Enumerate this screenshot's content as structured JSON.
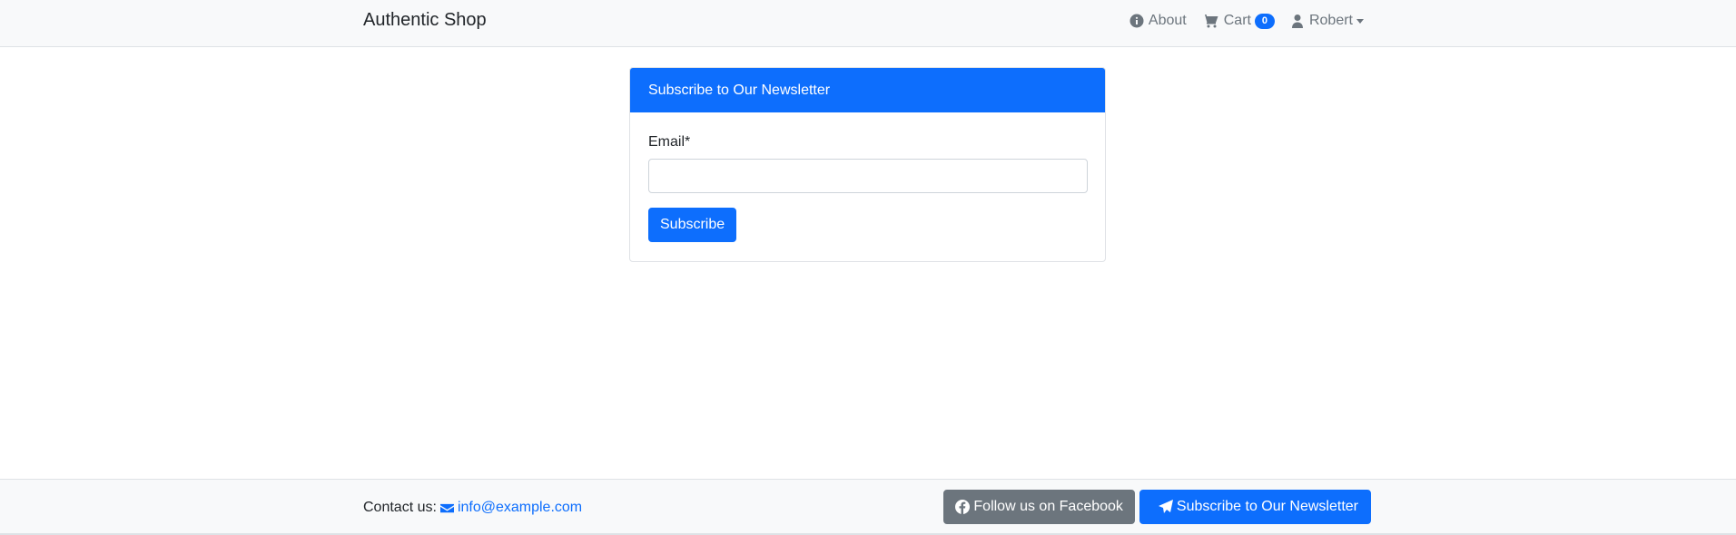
{
  "navbar": {
    "brand": "Authentic Shop",
    "about_label": "About",
    "about_icon": "info-circle-icon",
    "cart_label": "Cart",
    "cart_icon": "shopping-cart-icon",
    "cart_count": "0",
    "user_label": "Robert",
    "user_icon": "user-icon"
  },
  "card": {
    "header": "Subscribe to Our Newsletter",
    "email_label": "Email*",
    "email_value": "",
    "email_placeholder": "",
    "submit_label": "Subscribe"
  },
  "footer": {
    "contact_label": "Contact us:",
    "contact_email": "info@example.com",
    "contact_icon": "envelope-icon",
    "facebook_label": "Follow us on Facebook",
    "facebook_icon": "facebook-icon",
    "newsletter_label": "Subscribe to Our Newsletter",
    "newsletter_icon": "paper-plane-icon"
  },
  "colors": {
    "primary": "#0d6efd",
    "secondary": "#6c757d",
    "navbar_bg": "#f8f9fa"
  }
}
